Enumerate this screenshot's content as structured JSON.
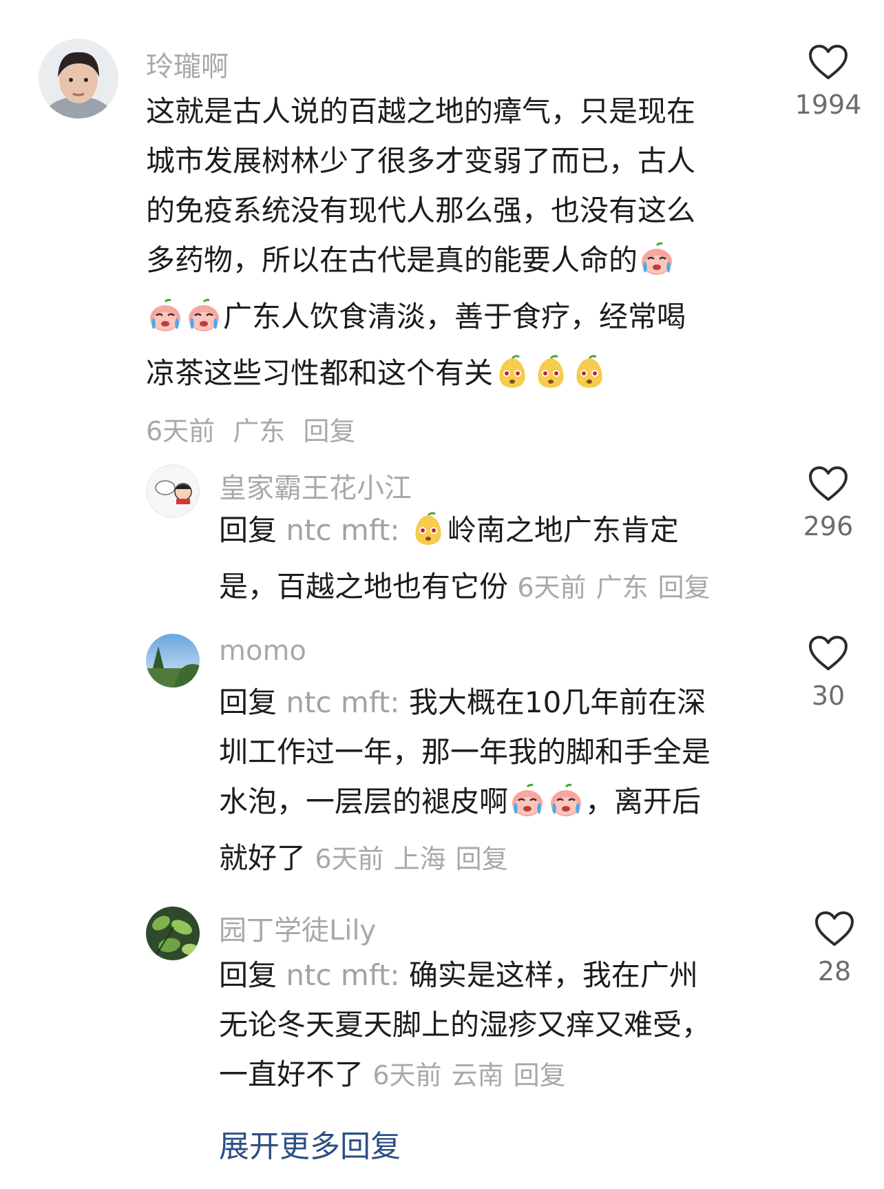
{
  "comments": [
    {
      "username": "玲瓏啊",
      "text_lines": [
        "这就是古人说的百越之地的瘴气，只是现在",
        "城市发展树林少了很多才变弱了而已，古人",
        "的免疫系统没有现代人那么强，也没有这么",
        "多药物，所以在古代是真的能要人命的"
      ],
      "line5": "广东人饮食清淡，善于食疗，经常喝",
      "line6": "凉茶这些习性都和这个有关",
      "time": "6天前",
      "location": "广东",
      "reply_label": "回复",
      "like_count": "1994"
    },
    {
      "username": "皇家霸王花小江",
      "reply_prefix": "回复",
      "reply_to": "ntc mft:",
      "line1": "岭南之地广东肯定",
      "line2": "是，百越之地也有它份",
      "time": "6天前",
      "location": "广东",
      "reply_label": "回复",
      "like_count": "296"
    },
    {
      "username": "momo",
      "reply_prefix": "回复",
      "reply_to": "ntc mft:",
      "line1": "我大概在10几年前在深",
      "line2": "圳工作过一年，那一年我的脚和手全是",
      "line3a": "水泡，一层层的褪皮啊",
      "line3b": "，离开后",
      "line4": "就好了",
      "time": "6天前",
      "location": "上海",
      "reply_label": "回复",
      "like_count": "30"
    },
    {
      "username": "园丁学徒Lily",
      "reply_prefix": "回复",
      "reply_to": "ntc mft:",
      "line1": "确实是这样，我在广州",
      "line2": "无论冬天夏天脚上的湿疹又痒又难受，",
      "line3": "一直好不了",
      "time": "6天前",
      "location": "云南",
      "reply_label": "回复",
      "like_count": "28"
    }
  ],
  "more_replies": "展开更多回复",
  "icons": {
    "heart": "heart-outline-icon",
    "crying_emoji": "crying-peach-emoji",
    "pear_emoji": "pear-face-emoji"
  },
  "colors": {
    "username": "#a8a8ac",
    "text": "#1c1c1e",
    "meta": "#a8a8ac",
    "link": "#2c4f82"
  }
}
